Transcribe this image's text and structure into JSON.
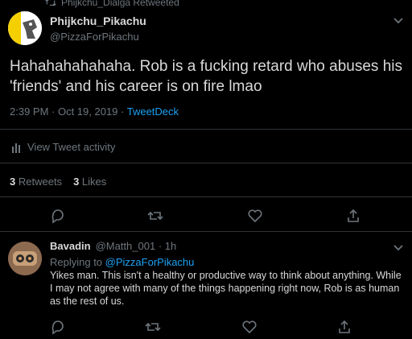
{
  "retweet_line": {
    "text": "Phijkchu_Dialga Retweeted"
  },
  "tweet": {
    "author_name": "Phijkchu_Pikachu",
    "author_handle": "@PizzaForPikachu",
    "text": "Hahahahahahaha. Rob is a fucking retard who abuses his 'friends' and his career is on fire lmao",
    "time": "2:39 PM · Oct 19, 2019 · ",
    "source": "TweetDeck",
    "activity_label": "View Tweet activity",
    "retweets_count": "3",
    "retweets_label": "Retweets",
    "likes_count": "3",
    "likes_label": "Likes"
  },
  "reply": {
    "author_name": "Bavadin",
    "author_handle": "@Matth_001 · 1h",
    "replying_label": "Replying to ",
    "replying_to": "@PizzaForPikachu",
    "text": "Yikes man. This isn't a healthy or productive way to think about anything. While I may not agree with many of the things happening right now, Rob is as human as the rest of us."
  },
  "icons": {
    "retweet": "retweet-icon",
    "reply": "reply-icon",
    "like": "heart-icon",
    "share": "share-icon",
    "more": "chevron-down-icon",
    "activity": "bar-chart-icon"
  },
  "colors": {
    "background": "#000000",
    "text": "#d9d9d9",
    "muted": "#6e767d",
    "accent": "#1da1f2",
    "divider": "#2f3336"
  }
}
